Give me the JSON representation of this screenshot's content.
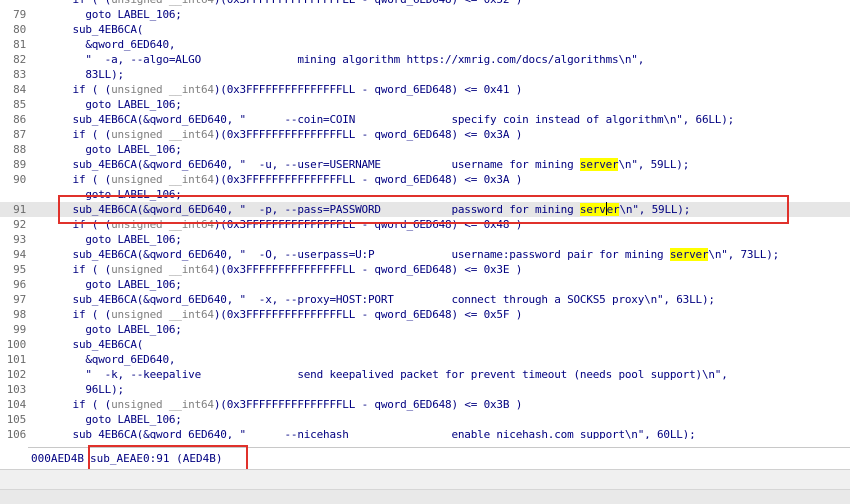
{
  "code_lines": [
    {
      "ln": "",
      "code": "      if ( (unsigned __int64)(0x3FFFFFFFFFFFFFFFLL - qword_6ED648) <= 0x52 )"
    },
    {
      "ln": "79",
      "code": "        goto LABEL_106;"
    },
    {
      "ln": "80",
      "code": "      sub_4EB6CA("
    },
    {
      "ln": "81",
      "code": "        &qword_6ED640,"
    },
    {
      "ln": "82",
      "code": "        \"  -a, --algo=ALGO               mining algorithm https://xmrig.com/docs/algorithms\\n\","
    },
    {
      "ln": "83",
      "code": "        83LL);"
    },
    {
      "ln": "84",
      "code": "      if ( (unsigned __int64)(0x3FFFFFFFFFFFFFFFLL - qword_6ED648) <= 0x41 )"
    },
    {
      "ln": "85",
      "code": "        goto LABEL_106;"
    },
    {
      "ln": "86",
      "code": "      sub_4EB6CA(&qword_6ED640, \"      --coin=COIN               specify coin instead of algorithm\\n\", 66LL);"
    },
    {
      "ln": "87",
      "code": "      if ( (unsigned __int64)(0x3FFFFFFFFFFFFFFFLL - qword_6ED648) <= 0x3A )"
    },
    {
      "ln": "88",
      "code": "        goto LABEL_106;"
    },
    {
      "ln": "89",
      "code": "      sub_4EB6CA(&qword_6ED640, \"  -u, --user=USERNAME           username for mining ",
      "hl": "server",
      "post": "\\n\", 59LL);"
    },
    {
      "ln": "90",
      "code": "      if ( (unsigned __int64)(0x3FFFFFFFFFFFFFFFLL - qword_6ED648) <= 0x3A )"
    },
    {
      "ln": "",
      "code": "        goto LABEL_106;"
    },
    {
      "ln": "91",
      "code": "      sub_4EB6CA(&qword_6ED640, \"  -p, --pass=PASSWORD           password for mining ",
      "hl": "server",
      "post": "\\n\", 59LL);",
      "current": true
    },
    {
      "ln": "92",
      "code": "      if ( (unsigned __int64)(0x3FFFFFFFFFFFFFFFLL - qword_6ED648) <= 0x48 )"
    },
    {
      "ln": "93",
      "code": "        goto LABEL_106;"
    },
    {
      "ln": "94",
      "code": "      sub_4EB6CA(&qword_6ED640, \"  -O, --userpass=U:P            username:password pair for mining ",
      "hl": "server",
      "post": "\\n\", 73LL);"
    },
    {
      "ln": "95",
      "code": "      if ( (unsigned __int64)(0x3FFFFFFFFFFFFFFFLL - qword_6ED648) <= 0x3E )"
    },
    {
      "ln": "96",
      "code": "        goto LABEL_106;"
    },
    {
      "ln": "97",
      "code": "      sub_4EB6CA(&qword_6ED640, \"  -x, --proxy=HOST:PORT         connect through a SOCKS5 proxy\\n\", 63LL);"
    },
    {
      "ln": "98",
      "code": "      if ( (unsigned __int64)(0x3FFFFFFFFFFFFFFFLL - qword_6ED648) <= 0x5F )"
    },
    {
      "ln": "99",
      "code": "        goto LABEL_106;"
    },
    {
      "ln": "100",
      "code": "      sub_4EB6CA("
    },
    {
      "ln": "101",
      "code": "        &qword_6ED640,"
    },
    {
      "ln": "102",
      "code": "        \"  -k, --keepalive               send keepalived packet for prevent timeout (needs pool support)\\n\","
    },
    {
      "ln": "103",
      "code": "        96LL);"
    },
    {
      "ln": "104",
      "code": "      if ( (unsigned __int64)(0x3FFFFFFFFFFFFFFFLL - qword_6ED648) <= 0x3B )"
    },
    {
      "ln": "105",
      "code": "        goto LABEL_106;"
    },
    {
      "ln": "106",
      "code": "      sub_4EB6CA(&qword_6ED640, \"      --nicehash                enable nicehash.com support\\n\", 60LL);"
    }
  ],
  "status_bar": {
    "address": "000AED4B",
    "function": "sub_AEAE0:91 (AED4B)"
  },
  "colors": {
    "code_text": "#000080",
    "comment_text": "#808080",
    "highlight": "#ffff00",
    "current_line": "#e6e6e6",
    "annotation_box": "#e0312b"
  }
}
